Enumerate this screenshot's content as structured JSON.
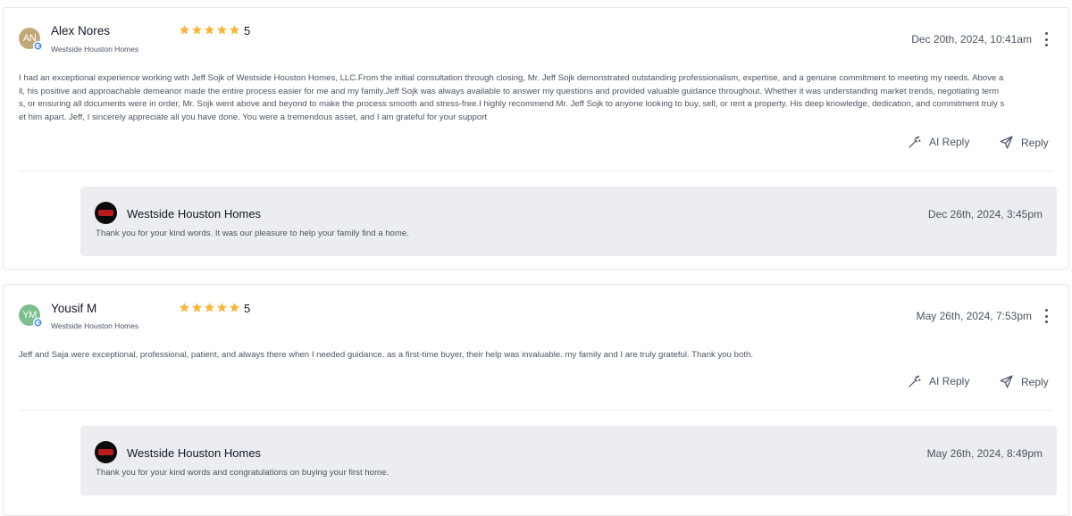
{
  "reviews": [
    {
      "avatar_initials": "AN",
      "avatar_color": "#c2a878",
      "name": "Alex Nores",
      "company": "Westside Houston Homes",
      "rating": "5",
      "date": "Dec 20th, 2024, 10:41am",
      "text": "I had an exceptional experience working with Jeff Sojk of Westside Houston Homes, LLC.From the initial consultation through closing, Mr. Jeff Sojk demonstrated outstanding professionalism, expertise, and a genuine commitment to meeting my needs. Above all, his positive and approachable demeanor made the entire process easier for me and my family.Jeff Sojk was always available to answer my questions and provided valuable guidance throughout. Whether it was understanding market trends, negotiating terms, or ensuring all documents were in order, Mr. Sojk went above and beyond to make the process smooth and stress-free.I highly recommend Mr. Jeff Sojk to anyone looking to buy, sell, or rent a property. His deep knowledge, dedication, and commitment truly set him apart. Jeff, I sincerely appreciate all you have done. You were a tremendous asset, and I am grateful for your support",
      "ai_reply_label": "AI Reply",
      "reply_label": "Reply",
      "response": {
        "business_name": "Westside Houston Homes",
        "date": "Dec 26th, 2024, 3:45pm",
        "text": "Thank you for your kind words. It was our pleasure to help your family find a home."
      }
    },
    {
      "avatar_initials": "YM",
      "avatar_color": "#7dbf8e",
      "name": "Yousif M",
      "company": "Westside Houston Homes",
      "rating": "5",
      "date": "May 26th, 2024, 7:53pm",
      "text": "Jeff and Saja were exceptional, professional, patient, and always there when I needed guidance. as a first-time buyer, their help was invaluable. my family and I are truly grateful. Thank you both.",
      "ai_reply_label": "AI Reply",
      "reply_label": "Reply",
      "response": {
        "business_name": "Westside Houston Homes",
        "date": "May 26th, 2024, 8:49pm",
        "text": "Thank you for your kind words and congratulations on buying your first home."
      }
    }
  ],
  "colors": {
    "star": "#f5b83d",
    "reply_background": "#ebedf0",
    "google_blue": "#4285f4"
  },
  "icons": {
    "star": "star-icon",
    "google": "google-icon",
    "ai_reply": "magic-wand-icon",
    "reply": "send-icon",
    "more": "more-vertical-icon"
  }
}
